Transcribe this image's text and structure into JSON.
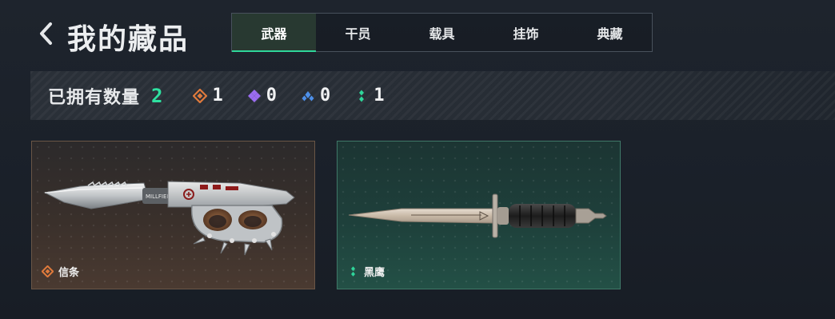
{
  "header": {
    "title": "我的藏品",
    "tabs": [
      {
        "label": "武器",
        "active": true
      },
      {
        "label": "干员",
        "active": false
      },
      {
        "label": "载具",
        "active": false
      },
      {
        "label": "挂饰",
        "active": false
      },
      {
        "label": "典藏",
        "active": false
      }
    ]
  },
  "stats": {
    "label": "已拥有数量",
    "total": "2",
    "rarities": [
      {
        "icon": "orange-diamond-icon",
        "color": "#e07a3c",
        "count": "1"
      },
      {
        "icon": "purple-diamond-icon",
        "color": "#9a6cf0",
        "count": "0"
      },
      {
        "icon": "blue-triangle-icon",
        "color": "#4d8fe8",
        "count": "0"
      },
      {
        "icon": "green-dots-icon",
        "color": "#2fd69a",
        "count": "1"
      }
    ]
  },
  "items": [
    {
      "name": "信条",
      "rarity_color": "#e07a3c",
      "icon": "orange-diamond-icon",
      "weapon": "knuckle-knife"
    },
    {
      "name": "黑鹰",
      "rarity_color": "#2fd69a",
      "icon": "green-dots-icon",
      "weapon": "combat-knife"
    }
  ],
  "colors": {
    "accent": "#2fd69a"
  }
}
